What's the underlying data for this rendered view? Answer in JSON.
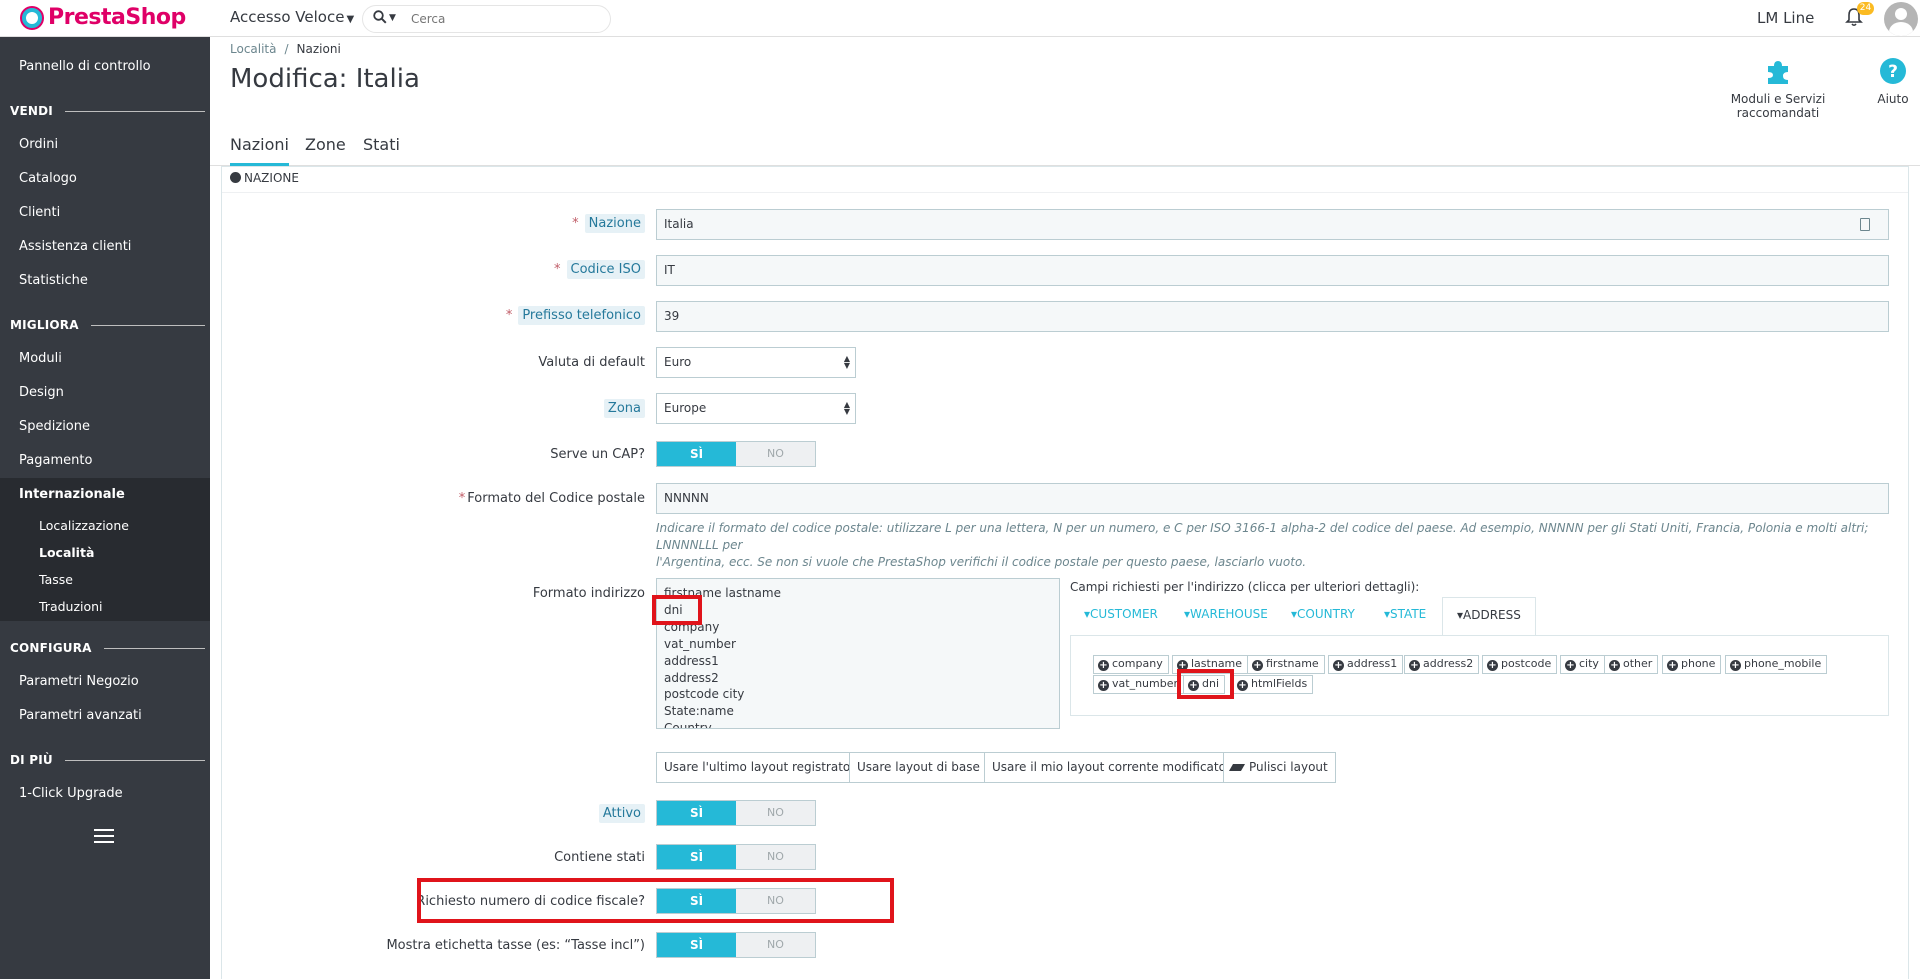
{
  "header": {
    "logo_text": "PrestaShop",
    "quick_access": "Accesso Veloce",
    "search_placeholder": "Cerca",
    "shop_name": "LM Line",
    "notifications_count": "24"
  },
  "sidebar": {
    "dashboard": "Pannello di controllo",
    "sections": [
      {
        "title": "VENDI",
        "items": [
          "Ordini",
          "Catalogo",
          "Clienti",
          "Assistenza clienti",
          "Statistiche"
        ]
      },
      {
        "title": "MIGLIORA",
        "items": [
          "Moduli",
          "Design",
          "Spedizione",
          "Pagamento",
          "Internazionale"
        ]
      },
      {
        "title": "CONFIGURA",
        "items": [
          "Parametri Negozio",
          "Parametri avanzati"
        ]
      },
      {
        "title": "DI PIÙ",
        "items": [
          "1-Click Upgrade"
        ]
      }
    ],
    "subitems": [
      "Localizzazione",
      "Località",
      "Tasse",
      "Traduzioni"
    ]
  },
  "breadcrumb": {
    "parent": "Località",
    "current": "Nazioni"
  },
  "page_title": "Modifica: Italia",
  "toolbar": {
    "modules_label": "Moduli e Servizi raccomandati",
    "help_label": "Aiuto"
  },
  "tabs": [
    "Nazioni",
    "Zone",
    "Stati"
  ],
  "panel": {
    "heading": "NAZIONE",
    "fields": {
      "country_label": "Nazione",
      "country_value": "Italia",
      "iso_label": "Codice ISO",
      "iso_value": "IT",
      "prefix_label": "Prefisso telefonico",
      "prefix_value": "39",
      "currency_label": "Valuta di default",
      "currency_value": "Euro",
      "zone_label": "Zona",
      "zone_value": "Europe",
      "need_zip_label": "Serve un CAP?",
      "zip_format_label": "Formato del Codice postale",
      "zip_format_value": "NNNNN",
      "zip_help_line1": "Indicare il formato del codice postale: utilizzare L per una lettera, N per un numero, e C per ISO 3166-1 alpha-2 del codice del paese. Ad esempio, NNNNN per gli Stati Uniti, Francia, Polonia e molti altri; LNNNNLLL per",
      "zip_help_line2": "l'Argentina, ecc. Se non si vuole che PrestaShop verifichi il codice postale per questo paese, lasciarlo vuoto.",
      "address_format_label": "Formato indirizzo",
      "address_lines": [
        "firstname lastname",
        "dni",
        "company",
        "vat_number",
        "address1",
        "address2",
        "postcode city",
        "State:name",
        "Country"
      ],
      "required_fields_label": "Campi richiesti per l'indirizzo (clicca per ulteriori dettagli):",
      "address_tabs": [
        "CUSTOMER",
        "WAREHOUSE",
        "COUNTRY",
        "STATE",
        "ADDRESS"
      ],
      "address_fields_row1": [
        "company",
        "lastname",
        "firstname",
        "address1",
        "address2",
        "postcode",
        "city",
        "other",
        "phone",
        "phone_mobile"
      ],
      "address_fields_row2": [
        "vat_number",
        "dni",
        "htmlFields"
      ],
      "layout_buttons": [
        "Usare l'ultimo layout registrato",
        "Usare layout di base",
        "Usare il mio layout corrente modificato",
        "Pulisci layout"
      ],
      "active_label": "Attivo",
      "contains_states_label": "Contiene stati",
      "need_tax_id_label": "Richiesto numero di codice fiscale?",
      "display_tax_label": "Mostra etichetta tasse (es: “Tasse incl”)",
      "switch_yes": "SÌ",
      "switch_no": "NO"
    }
  },
  "colors": {
    "accent": "#25b9d7",
    "sidebar": "#363a41",
    "highlight": "#e0141b",
    "brand": "#df0067"
  }
}
